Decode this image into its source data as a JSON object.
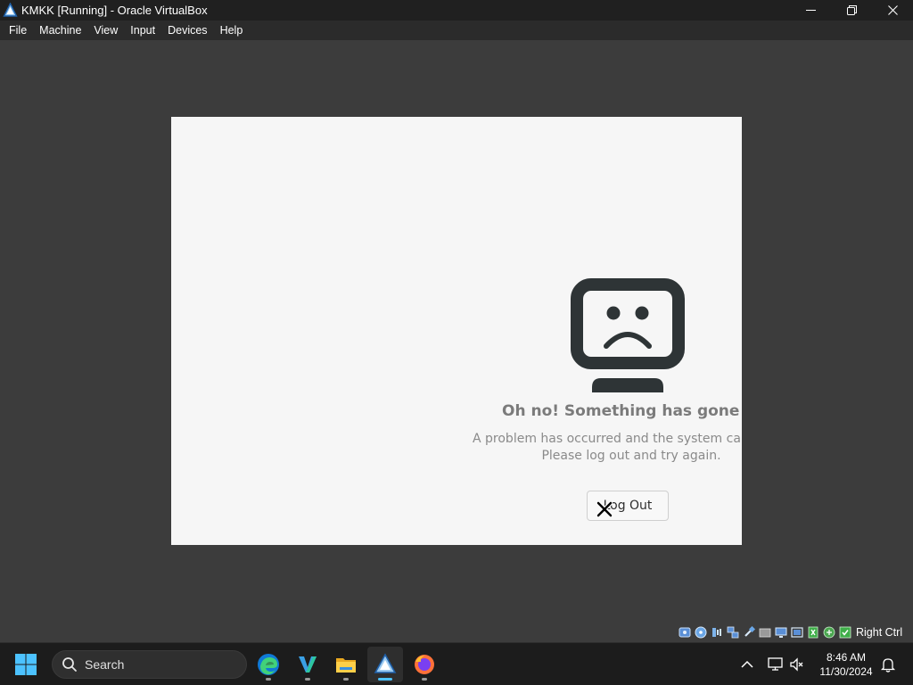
{
  "window": {
    "title": "KMKK [Running] - Oracle VirtualBox",
    "controls": {
      "minimize": "—",
      "maximize": "❐",
      "close": "✕"
    }
  },
  "menubar": {
    "items": [
      {
        "label": "File"
      },
      {
        "label": "Machine"
      },
      {
        "label": "View"
      },
      {
        "label": "Input"
      },
      {
        "label": "Devices"
      },
      {
        "label": "Help"
      }
    ]
  },
  "vm": {
    "error_title": "Oh no!  Something has gone wrong.",
    "error_line1": "A problem has occurred and the system can't recover.",
    "error_line2": "Please log out and try again.",
    "logout_label": "Log Out"
  },
  "statusbar": {
    "host_key": "Right Ctrl",
    "icons": [
      "hard-disk-icon",
      "optical-drive-icon",
      "audio-icon",
      "network-icon",
      "usb-icon",
      "shared-folders-icon",
      "display-icon",
      "video-capture-icon",
      "cpu-icon",
      "mouse-integration-icon",
      "guest-additions-icon"
    ]
  },
  "taskbar": {
    "search_label": "Search",
    "apps": [
      "edge-icon",
      "visual-studio-icon",
      "file-explorer-icon",
      "virtualbox-icon",
      "firefox-icon"
    ],
    "clock_time": "8:46 AM",
    "clock_date": "11/30/2024"
  },
  "colors": {
    "vm_background": "#f6f6f6",
    "host_background": "#3c3c3c",
    "taskbar": "#1c1c1c",
    "accent": "#4cc2ff",
    "monitor_icon": "#2e3436"
  }
}
